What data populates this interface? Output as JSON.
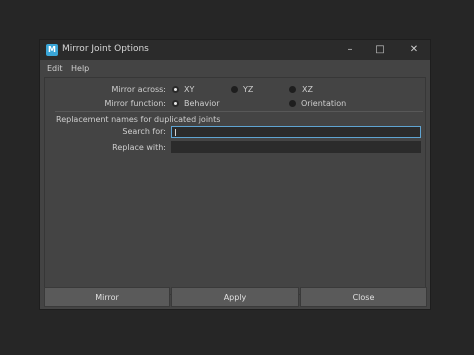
{
  "window": {
    "title": "Mirror Joint Options",
    "app_icon": "M",
    "controls": {
      "minimize": "minimize-icon",
      "maximize": "maximize-icon",
      "close": "close-icon"
    }
  },
  "menubar": {
    "items": [
      "Edit",
      "Help"
    ]
  },
  "options": {
    "mirror_across_label": "Mirror across:",
    "mirror_across_options": [
      "XY",
      "YZ",
      "XZ"
    ],
    "mirror_across_selected": "XY",
    "mirror_function_label": "Mirror function:",
    "mirror_function_options": [
      "Behavior",
      "Orientation"
    ],
    "mirror_function_selected": "Behavior"
  },
  "replacement": {
    "section_label": "Replacement names for duplicated joints",
    "search_label": "Search for:",
    "search_value": "",
    "replace_label": "Replace with:",
    "replace_value": ""
  },
  "buttons": {
    "mirror": "Mirror",
    "apply": "Apply",
    "close": "Close"
  },
  "colors": {
    "accent_focus": "#5fa4d2",
    "window_bg": "#444444"
  }
}
